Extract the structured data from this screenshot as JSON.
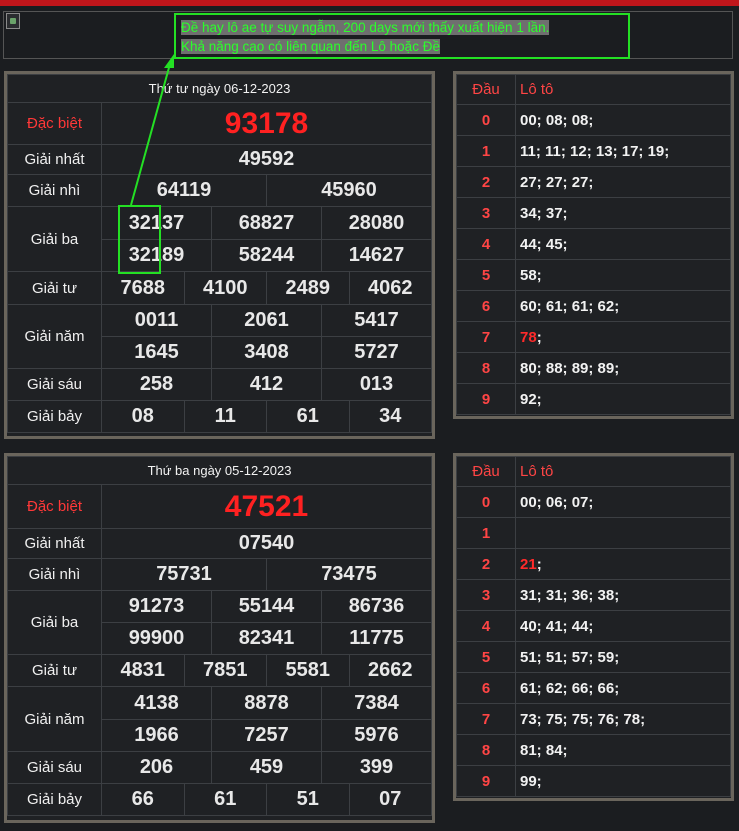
{
  "note": {
    "line1": "Đề hay lô ae tự suy ngẫm, 200 days mới thấy xuất hiện 1 lần.",
    "line2": "Khả năng cao có liên quan đến Lô hoặc Đề"
  },
  "draws": [
    {
      "date_header": "Thứ tư ngày 06-12-2023",
      "special": {
        "label": "Đặc biệt",
        "value": "93178"
      },
      "first": {
        "label": "Giải nhất",
        "value": "49592"
      },
      "second": {
        "label": "Giải nhì",
        "values": [
          "64119",
          "45960"
        ]
      },
      "third": {
        "label": "Giải ba",
        "values": [
          "32137",
          "68827",
          "28080",
          "32189",
          "58244",
          "14627"
        ]
      },
      "fourth": {
        "label": "Giải tư",
        "values": [
          "7688",
          "4100",
          "2489",
          "4062"
        ]
      },
      "fifth": {
        "label": "Giải năm",
        "values": [
          "0011",
          "2061",
          "5417",
          "1645",
          "3408",
          "5727"
        ]
      },
      "sixth": {
        "label": "Giải sáu",
        "values": [
          "258",
          "412",
          "013"
        ]
      },
      "seventh": {
        "label": "Giải bảy",
        "values": [
          "08",
          "11",
          "61",
          "34"
        ]
      },
      "loto": {
        "head_label": "Đầu",
        "loto_label": "Lô tô",
        "rows": [
          {
            "dau": "0",
            "pre": "00; 08; 08;",
            "hl": "",
            "post": ""
          },
          {
            "dau": "1",
            "pre": "11; 11; 12; 13; 17; 19;",
            "hl": "",
            "post": ""
          },
          {
            "dau": "2",
            "pre": "27; 27; 27;",
            "hl": "",
            "post": ""
          },
          {
            "dau": "3",
            "pre": "34; 37;",
            "hl": "",
            "post": ""
          },
          {
            "dau": "4",
            "pre": "44; 45;",
            "hl": "",
            "post": ""
          },
          {
            "dau": "5",
            "pre": "58;",
            "hl": "",
            "post": ""
          },
          {
            "dau": "6",
            "pre": "60; 61; 61; 62;",
            "hl": "",
            "post": ""
          },
          {
            "dau": "7",
            "pre": "",
            "hl": "78",
            "post": ";"
          },
          {
            "dau": "8",
            "pre": "80; 88; 89; 89;",
            "hl": "",
            "post": ""
          },
          {
            "dau": "9",
            "pre": "92;",
            "hl": "",
            "post": ""
          }
        ]
      }
    },
    {
      "date_header": "Thứ ba ngày 05-12-2023",
      "special": {
        "label": "Đặc biệt",
        "value": "47521"
      },
      "first": {
        "label": "Giải nhất",
        "value": "07540"
      },
      "second": {
        "label": "Giải nhì",
        "values": [
          "75731",
          "73475"
        ]
      },
      "third": {
        "label": "Giải ba",
        "values": [
          "91273",
          "55144",
          "86736",
          "99900",
          "82341",
          "11775"
        ]
      },
      "fourth": {
        "label": "Giải tư",
        "values": [
          "4831",
          "7851",
          "5581",
          "2662"
        ]
      },
      "fifth": {
        "label": "Giải năm",
        "values": [
          "4138",
          "8878",
          "7384",
          "1966",
          "7257",
          "5976"
        ]
      },
      "sixth": {
        "label": "Giải sáu",
        "values": [
          "206",
          "459",
          "399"
        ]
      },
      "seventh": {
        "label": "Giải bảy",
        "values": [
          "66",
          "61",
          "51",
          "07"
        ]
      },
      "loto": {
        "head_label": "Đầu",
        "loto_label": "Lô tô",
        "rows": [
          {
            "dau": "0",
            "pre": "00; 06; 07;",
            "hl": "",
            "post": ""
          },
          {
            "dau": "1",
            "pre": "",
            "hl": "",
            "post": ""
          },
          {
            "dau": "2",
            "pre": "",
            "hl": "21",
            "post": ";"
          },
          {
            "dau": "3",
            "pre": "31; 31; 36; 38;",
            "hl": "",
            "post": ""
          },
          {
            "dau": "4",
            "pre": "40; 41; 44;",
            "hl": "",
            "post": ""
          },
          {
            "dau": "5",
            "pre": "51; 51; 57; 59;",
            "hl": "",
            "post": ""
          },
          {
            "dau": "6",
            "pre": "61; 62; 66; 66;",
            "hl": "",
            "post": ""
          },
          {
            "dau": "7",
            "pre": "73; 75; 75; 76; 78;",
            "hl": "",
            "post": ""
          },
          {
            "dau": "8",
            "pre": "81; 84;",
            "hl": "",
            "post": ""
          },
          {
            "dau": "9",
            "pre": "99;",
            "hl": "",
            "post": ""
          }
        ]
      }
    }
  ],
  "colors": {
    "accent_red": "#ff2121",
    "highlight_green": "#24e024",
    "frame": "#6a655c"
  }
}
